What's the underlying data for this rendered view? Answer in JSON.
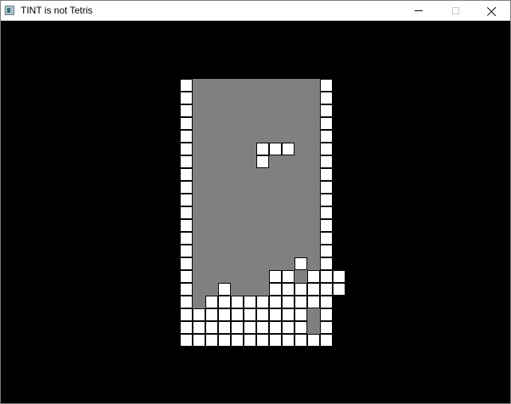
{
  "window": {
    "title": "TINT is not Tetris",
    "icon": "app-window-icon",
    "controls": [
      "minimize",
      "maximize",
      "close"
    ]
  },
  "game": {
    "colors": {
      "background": "#000000",
      "well": "#808080",
      "block": "#ffffff",
      "block_border": "#000000"
    },
    "wall_columns": [
      0,
      11
    ],
    "floor_row": 20,
    "active_piece": [
      [
        6,
        5
      ],
      [
        7,
        5
      ],
      [
        8,
        5
      ],
      [
        6,
        6
      ]
    ],
    "stack": [
      [
        9,
        14
      ],
      [
        7,
        15
      ],
      [
        8,
        15
      ],
      [
        10,
        15
      ],
      [
        11,
        15
      ],
      [
        12,
        15
      ],
      [
        3,
        16
      ],
      [
        7,
        16
      ],
      [
        8,
        16
      ],
      [
        9,
        16
      ],
      [
        10,
        16
      ],
      [
        11,
        16
      ],
      [
        12,
        16
      ],
      [
        3,
        17
      ],
      [
        2,
        17
      ],
      [
        4,
        17
      ],
      [
        5,
        17
      ],
      [
        6,
        17
      ],
      [
        7,
        17
      ],
      [
        8,
        17
      ],
      [
        9,
        17
      ],
      [
        10,
        17
      ],
      [
        1,
        18
      ],
      [
        2,
        18
      ],
      [
        3,
        18
      ],
      [
        4,
        18
      ],
      [
        5,
        18
      ],
      [
        6,
        18
      ],
      [
        7,
        18
      ],
      [
        8,
        18
      ],
      [
        9,
        18
      ],
      [
        1,
        19
      ],
      [
        2,
        19
      ],
      [
        3,
        19
      ],
      [
        4,
        19
      ],
      [
        5,
        19
      ],
      [
        6,
        19
      ],
      [
        7,
        19
      ],
      [
        8,
        19
      ],
      [
        9,
        19
      ]
    ]
  }
}
